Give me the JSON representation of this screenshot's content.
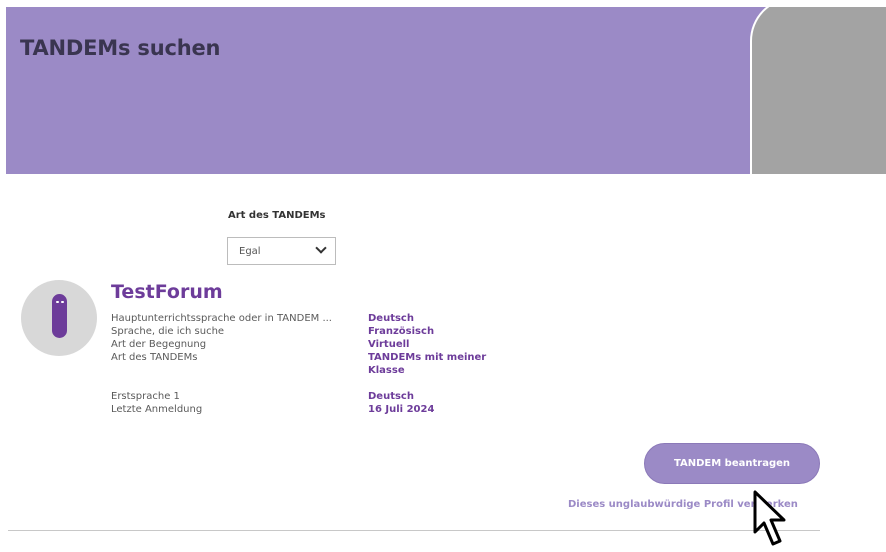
{
  "page": {
    "title": "TANDEMs suchen"
  },
  "filter": {
    "label": "Art des TANDEMs",
    "selected": "Egal"
  },
  "profile": {
    "name": "TestForum",
    "attributes": [
      {
        "label": "Hauptunterrichtssprache oder in TANDEM ...",
        "value": "Deutsch"
      },
      {
        "label": "Sprache, die ich suche",
        "value": "Französisch"
      },
      {
        "label": "Art der Begegnung",
        "value": "Virtuell"
      },
      {
        "label": "Art des TANDEMs",
        "value": "TANDEMs mit meiner Klasse"
      },
      {
        "label": "Erstsprache 1",
        "value": "Deutsch"
      },
      {
        "label": "Letzte Anmeldung",
        "value": "16 Juli 2024"
      }
    ]
  },
  "actions": {
    "request_button": "TANDEM beantragen",
    "report_link": "Dieses unglaubwürdige Profil vermerken"
  },
  "colors": {
    "accent": "#9b8ac6",
    "brand_purple": "#6d3c9a"
  }
}
